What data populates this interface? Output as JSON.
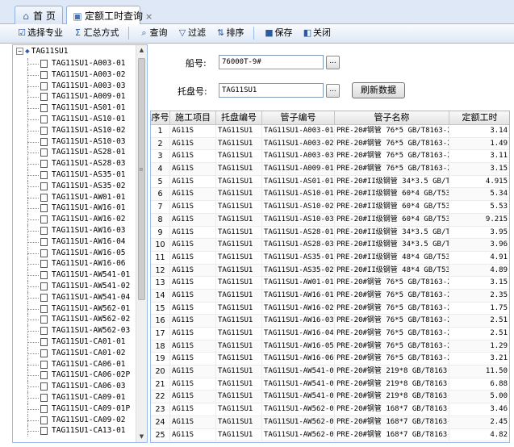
{
  "tabs": [
    {
      "icon": "home-icon",
      "label": "首 页"
    },
    {
      "icon": "window-icon",
      "label": "定额工时查询",
      "close": "×"
    }
  ],
  "toolbar": [
    {
      "icon": "select-icon",
      "label": "选择专业"
    },
    {
      "icon": "sum-icon",
      "label": "汇总方式"
    },
    {
      "icon": "search-icon",
      "label": "查询"
    },
    {
      "icon": "filter-icon",
      "label": "过滤"
    },
    {
      "icon": "sort-icon",
      "label": "排序"
    },
    {
      "icon": "save-icon",
      "label": "保存"
    },
    {
      "icon": "close-icon",
      "label": "关闭"
    }
  ],
  "tree": {
    "expander": "−",
    "root": "TAG11SU1",
    "items": [
      "TAG11SU1-A003-01",
      "TAG11SU1-A003-02",
      "TAG11SU1-A003-03",
      "TAG11SU1-A009-01",
      "TAG11SU1-AS01-01",
      "TAG11SU1-AS10-01",
      "TAG11SU1-AS10-02",
      "TAG11SU1-AS10-03",
      "TAG11SU1-AS28-01",
      "TAG11SU1-AS28-03",
      "TAG11SU1-AS35-01",
      "TAG11SU1-AS35-02",
      "TAG11SU1-AW01-01",
      "TAG11SU1-AW16-01",
      "TAG11SU1-AW16-02",
      "TAG11SU1-AW16-03",
      "TAG11SU1-AW16-04",
      "TAG11SU1-AW16-05",
      "TAG11SU1-AW16-06",
      "TAG11SU1-AW541-01",
      "TAG11SU1-AW541-02",
      "TAG11SU1-AW541-04",
      "TAG11SU1-AW562-01",
      "TAG11SU1-AW562-02",
      "TAG11SU1-AW562-03",
      "TAG11SU1-CA01-01",
      "TAG11SU1-CA01-02",
      "TAG11SU1-CA06-01",
      "TAG11SU1-CA06-02P",
      "TAG11SU1-CA06-03",
      "TAG11SU1-CA09-01",
      "TAG11SU1-CA09-01P",
      "TAG11SU1-CA09-02",
      "TAG11SU1-CA13-01"
    ]
  },
  "form": {
    "ship_label": "船号:",
    "ship_value": "76000T-9#",
    "tray_label": "托盘号:",
    "tray_value": "TAG11SU1",
    "browse": "...",
    "refresh_label": "刷新数据"
  },
  "grid": {
    "columns": [
      "序号",
      "施工项目",
      "托盘编号",
      "管子编号",
      "管子名称",
      "定额工时"
    ],
    "rows": [
      [
        "1",
        "AG11S",
        "TAG11SU1",
        "TAG11SU1-A003-01",
        "PRE-20#钢管 76*5 GB/T8163-2008",
        "3.14"
      ],
      [
        "2",
        "AG11S",
        "TAG11SU1",
        "TAG11SU1-A003-02",
        "PRE-20#钢管 76*5 GB/T8163-2008",
        "1.49"
      ],
      [
        "3",
        "AG11S",
        "TAG11SU1",
        "TAG11SU1-A003-03",
        "PRE-20#钢管 76*5 GB/T8163-2008",
        "3.11"
      ],
      [
        "4",
        "AG11S",
        "TAG11SU1",
        "TAG11SU1-A009-01",
        "PRE-20#钢管 76*5 GB/T8163-2008",
        "3.15"
      ],
      [
        "5",
        "AG11S",
        "TAG11SU1",
        "TAG11SU1-AS01-01",
        "PRE-20#II级钢管 34*3.5 GB/T531",
        "4.915"
      ],
      [
        "6",
        "AG11S",
        "TAG11SU1",
        "TAG11SU1-AS10-01",
        "PRE-20#II级钢管 60*4 GB/T5312-",
        "5.34"
      ],
      [
        "7",
        "AG11S",
        "TAG11SU1",
        "TAG11SU1-AS10-02",
        "PRE-20#II级钢管 60*4 GB/T5312-",
        "5.53"
      ],
      [
        "8",
        "AG11S",
        "TAG11SU1",
        "TAG11SU1-AS10-03",
        "PRE-20#II级钢管 60*4 GB/T5312-",
        "9.215"
      ],
      [
        "9",
        "AG11S",
        "TAG11SU1",
        "TAG11SU1-AS28-01",
        "PRE-20#II级钢管 34*3.5 GB/T531",
        "3.95"
      ],
      [
        "10",
        "AG11S",
        "TAG11SU1",
        "TAG11SU1-AS28-03",
        "PRE-20#II级钢管 34*3.5 GB/T531",
        "3.96"
      ],
      [
        "11",
        "AG11S",
        "TAG11SU1",
        "TAG11SU1-AS35-01",
        "PRE-20#II级钢管 48*4 GB/T5312-",
        "4.91"
      ],
      [
        "12",
        "AG11S",
        "TAG11SU1",
        "TAG11SU1-AS35-02",
        "PRE-20#II级钢管 48*4 GB/T5312-",
        "4.89"
      ],
      [
        "13",
        "AG11S",
        "TAG11SU1",
        "TAG11SU1-AW01-01",
        "PRE-20#钢管 76*5 GB/T8163-2008",
        "3.15"
      ],
      [
        "14",
        "AG11S",
        "TAG11SU1",
        "TAG11SU1-AW16-01",
        "PRE-20#钢管 76*5 GB/T8163-2008",
        "2.35"
      ],
      [
        "15",
        "AG11S",
        "TAG11SU1",
        "TAG11SU1-AW16-02",
        "PRE-20#钢管 76*5 GB/T8163-2008",
        "1.75"
      ],
      [
        "16",
        "AG11S",
        "TAG11SU1",
        "TAG11SU1-AW16-03",
        "PRE-20#钢管 76*5 GB/T8163-2008",
        "2.51"
      ],
      [
        "17",
        "AG11S",
        "TAG11SU1",
        "TAG11SU1-AW16-04",
        "PRE-20#钢管 76*5 GB/T8163-2008",
        "2.51"
      ],
      [
        "18",
        "AG11S",
        "TAG11SU1",
        "TAG11SU1-AW16-05",
        "PRE-20#钢管 76*5 GB/T8163-2008",
        "1.29"
      ],
      [
        "19",
        "AG11S",
        "TAG11SU1",
        "TAG11SU1-AW16-06",
        "PRE-20#钢管 76*5 GB/T8163-2008",
        "3.21"
      ],
      [
        "20",
        "AG11S",
        "TAG11SU1",
        "TAG11SU1-AW541-01",
        "PRE-20#钢管 219*8 GB/T8163-200",
        "11.50"
      ],
      [
        "21",
        "AG11S",
        "TAG11SU1",
        "TAG11SU1-AW541-02",
        "PRE-20#钢管 219*8 GB/T8163-200",
        "6.88"
      ],
      [
        "22",
        "AG11S",
        "TAG11SU1",
        "TAG11SU1-AW541-04",
        "PRE-20#钢管 219*8 GB/T8163-200",
        "5.00"
      ],
      [
        "23",
        "AG11S",
        "TAG11SU1",
        "TAG11SU1-AW562-01",
        "PRE-20#钢管 168*7 GB/T8163-200",
        "3.46"
      ],
      [
        "24",
        "AG11S",
        "TAG11SU1",
        "TAG11SU1-AW562-02",
        "PRE-20#钢管 168*7 GB/T8163-200",
        "2.45"
      ],
      [
        "25",
        "AG11S",
        "TAG11SU1",
        "TAG11SU1-AW562-03",
        "PRE-20#钢管 168*7 GB/T8163-200",
        "4.82"
      ]
    ]
  }
}
